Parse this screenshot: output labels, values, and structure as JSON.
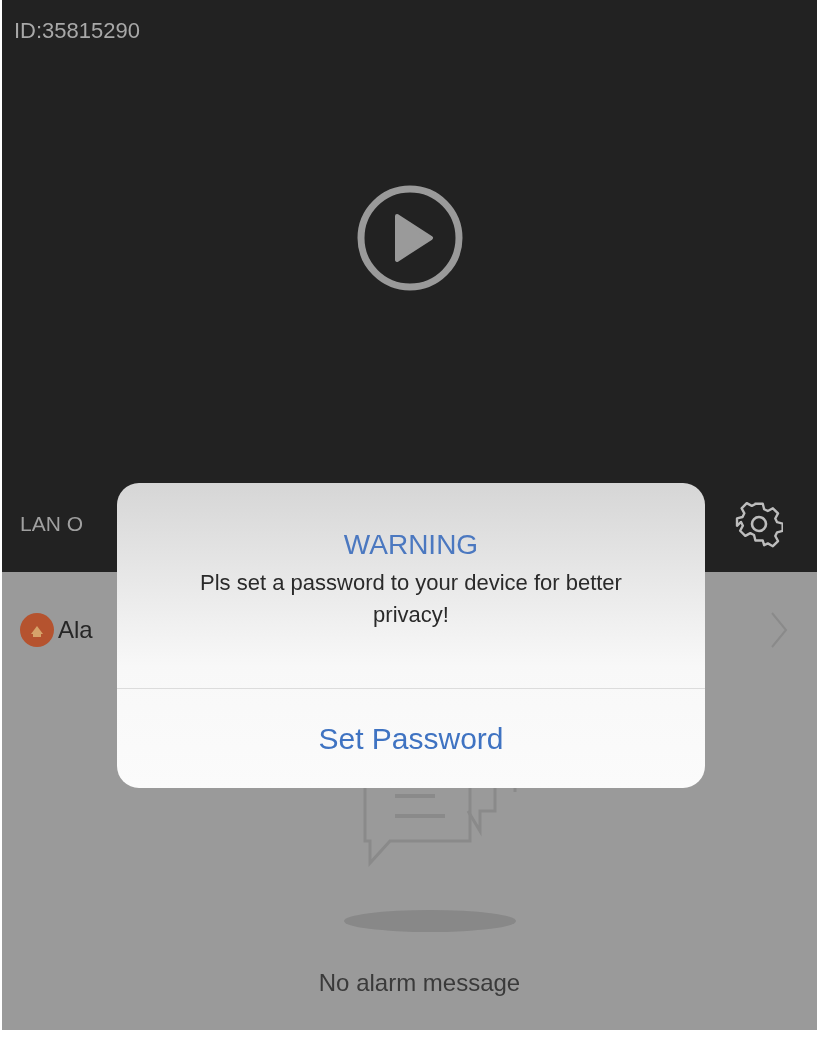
{
  "video": {
    "device_id": "ID:35815290",
    "connection": "LAN O"
  },
  "alarm_row": {
    "label": "Ala"
  },
  "empty_state": {
    "message": "No alarm message"
  },
  "dialog": {
    "title": "WARNING",
    "message": "Pls set a password to your device for better privacy!",
    "button": "Set Password"
  }
}
